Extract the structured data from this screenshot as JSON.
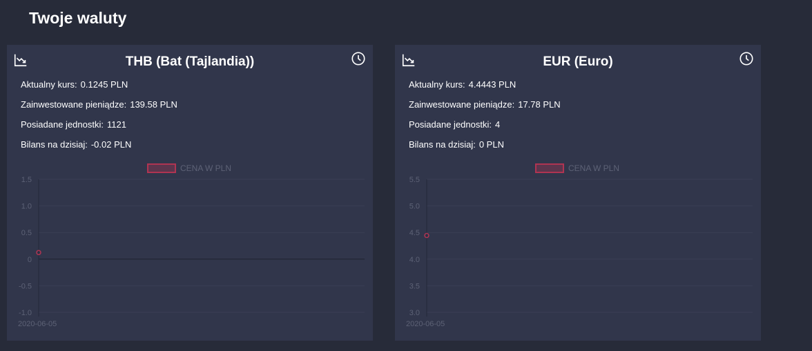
{
  "page": {
    "title": "Twoje waluty"
  },
  "colors": {
    "background": "#272b39",
    "card": "#31364b",
    "accent": "#b03452",
    "muted_text": "#5d6276"
  },
  "icons": {
    "chart": "trending-down-chart-icon",
    "history": "clock-icon"
  },
  "cards": [
    {
      "title": "THB (Bat (Tajlandia))",
      "rows": [
        {
          "label": "Aktualny kurs:",
          "value": "0.1245 PLN"
        },
        {
          "label": "Zainwestowane pieniądze:",
          "value": "139.58 PLN"
        },
        {
          "label": "Posiadane jednostki:",
          "value": "1121"
        },
        {
          "label": "Bilans na dzisiaj:",
          "value": "-0.02 PLN"
        }
      ]
    },
    {
      "title": "EUR (Euro)",
      "rows": [
        {
          "label": "Aktualny kurs:",
          "value": "4.4443 PLN"
        },
        {
          "label": "Zainwestowane pieniądze:",
          "value": "17.78 PLN"
        },
        {
          "label": "Posiadane jednostki:",
          "value": "4"
        },
        {
          "label": "Bilans na dzisiaj:",
          "value": "0 PLN"
        }
      ]
    }
  ],
  "chart_data": [
    {
      "type": "line",
      "legend": "CENA W PLN",
      "legend_position": "top-center",
      "grid": true,
      "ylim": [
        -1.0,
        1.5
      ],
      "yticks": [
        "1.5",
        "1.0",
        "0.5",
        "0",
        "-0.5",
        "-1.0"
      ],
      "x": [
        "2020-06-05"
      ],
      "series": [
        {
          "name": "CENA W PLN",
          "values": [
            0.1245
          ]
        }
      ]
    },
    {
      "type": "line",
      "legend": "CENA W PLN",
      "legend_position": "top-center",
      "grid": true,
      "ylim": [
        3.0,
        5.5
      ],
      "yticks": [
        "5.5",
        "5.0",
        "4.5",
        "4.0",
        "3.5",
        "3.0"
      ],
      "x": [
        "2020-06-05"
      ],
      "series": [
        {
          "name": "CENA W PLN",
          "values": [
            4.4443
          ]
        }
      ]
    }
  ]
}
